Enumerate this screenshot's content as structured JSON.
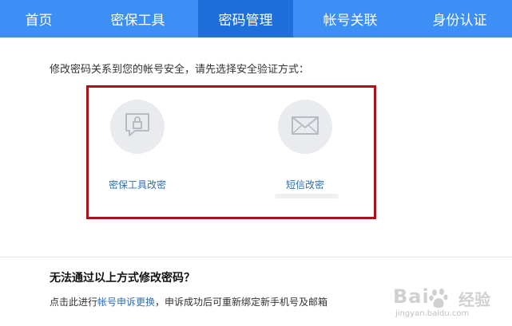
{
  "nav": {
    "tabs": [
      {
        "label": "首页",
        "active": false
      },
      {
        "label": "密保工具",
        "active": false
      },
      {
        "label": "密码管理",
        "active": true
      },
      {
        "label": "帐号关联",
        "active": false
      },
      {
        "label": "身份认证",
        "active": false
      }
    ],
    "bar_color": "#3d8ff5",
    "active_color": "#1f6fdb"
  },
  "main": {
    "instruction": "修改密码关系到您的帐号安全，请先选择安全验证方式：",
    "options": [
      {
        "label": "密保工具改密",
        "icon": "lock-chat-icon"
      },
      {
        "label": "短信改密",
        "icon": "envelope-icon"
      }
    ],
    "highlight_color": "#a8121c"
  },
  "help": {
    "title": "无法通过以上方式修改密码？",
    "text_before": "点击此进行",
    "link": "帐号申诉更换",
    "text_after": "，申诉成功后可重新绑定新手机号及邮箱"
  },
  "watermark": {
    "brand": "Bai",
    "cn": "经验",
    "sub": "jingyan.baidu.com"
  }
}
